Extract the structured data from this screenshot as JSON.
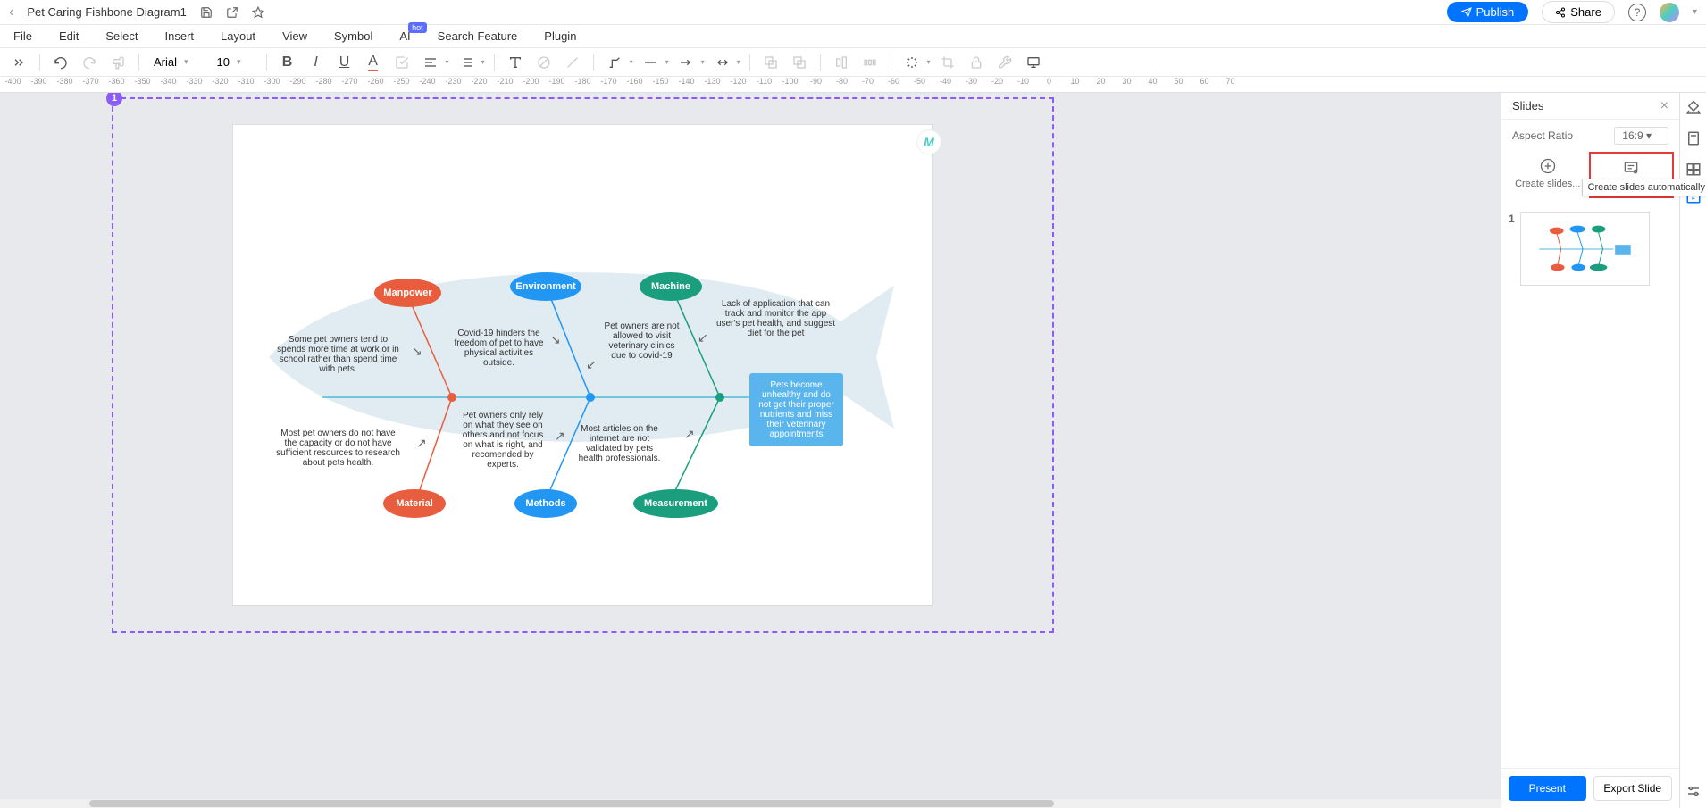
{
  "title_bar": {
    "doc_title": "Pet Caring Fishbone Diagram1",
    "publish": "Publish",
    "share": "Share"
  },
  "menu": {
    "file": "File",
    "edit": "Edit",
    "select": "Select",
    "insert": "Insert",
    "layout": "Layout",
    "view": "View",
    "symbol": "Symbol",
    "ai": "AI",
    "ai_badge": "hot",
    "search": "Search Feature",
    "plugin": "Plugin"
  },
  "toolbar": {
    "font": "Arial",
    "size": "10"
  },
  "ruler_start": -400,
  "ruler_step": 10,
  "selection_index": "1",
  "fishbone": {
    "causes_top": {
      "manpower": "Manpower",
      "environment": "Environment",
      "machine": "Machine"
    },
    "causes_bottom": {
      "material": "Material",
      "methods": "Methods",
      "measurement": "Measurement"
    },
    "texts": {
      "manpower_t": "Some pet owners tend to spends more time at work or in school rather than spend time with pets.",
      "environment_t": "Covid-19 hinders the freedom of pet to have physical activities outside.",
      "machine_t1": "Pet owners are not allowed to visit veterinary clinics due to covid-19",
      "machine_t2": "Lack of application that can track and monitor the app user's pet health, and suggest diet for the pet",
      "material_t": "Most pet owners do not have the capacity or do not have sufficient resources to research about pets health.",
      "methods_t": "Pet owners only rely on what they see on others and not focus on what is right, and recomended by experts.",
      "measurement_t": "Most articles on the internet are not validated by pets health professionals."
    },
    "result": "Pets become unhealthy and do not get their proper nutrients and miss their veterinary appointments"
  },
  "slides_panel": {
    "title": "Slides",
    "aspect_label": "Aspect Ratio",
    "aspect_value": "16:9",
    "create_manual": "Create slides...",
    "create_auto": "Create slides",
    "tooltip": "Create slides automatically",
    "thumb_num": "1",
    "present": "Present",
    "export": "Export Slide"
  }
}
